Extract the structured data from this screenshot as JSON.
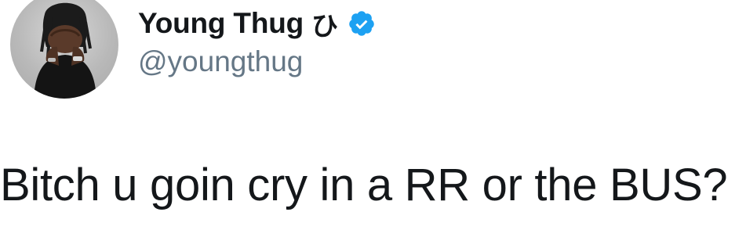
{
  "user": {
    "display_name": "Young Thug",
    "name_symbol": "ひ",
    "handle": "@youngthug",
    "verified": true,
    "verified_icon": "verified-badge-icon",
    "avatar_icon": "profile-photo"
  },
  "tweet": {
    "text": "Bitch u goin cry in a RR or the BUS?"
  },
  "colors": {
    "verified_blue": "#1da1f2",
    "handle_gray": "#657786",
    "text": "#14171a"
  }
}
